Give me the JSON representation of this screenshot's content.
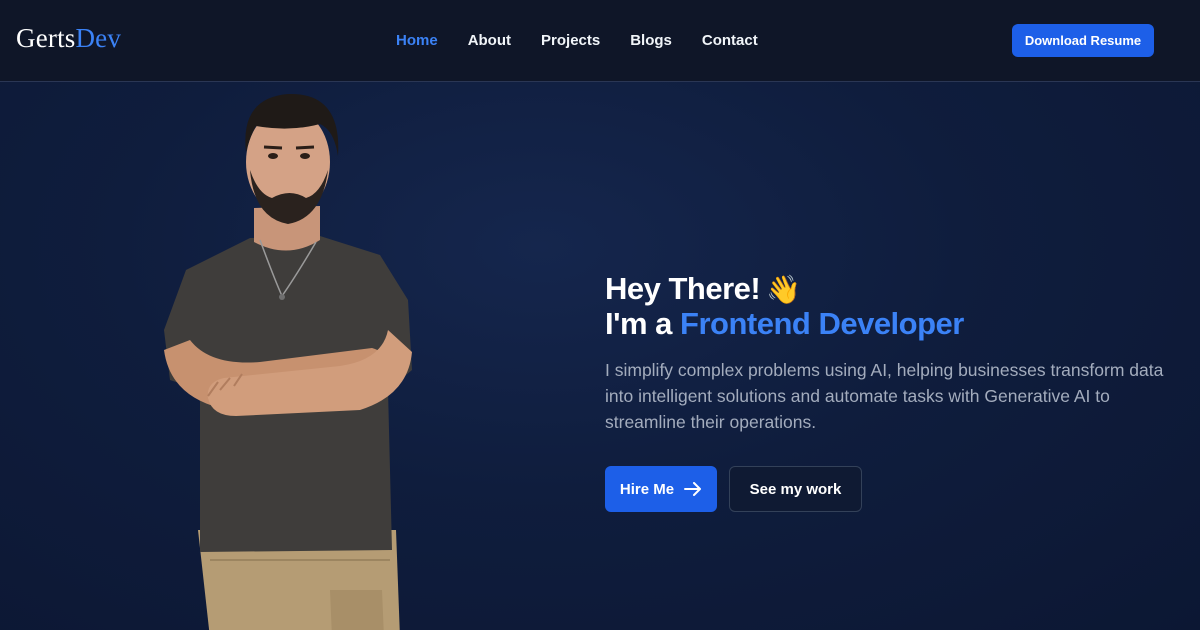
{
  "header": {
    "logo_primary": "Gerts",
    "logo_accent": "Dev",
    "nav": [
      {
        "label": "Home",
        "active": true
      },
      {
        "label": "About",
        "active": false
      },
      {
        "label": "Projects",
        "active": false
      },
      {
        "label": "Blogs",
        "active": false
      },
      {
        "label": "Contact",
        "active": false
      }
    ],
    "resume_label": "Download Resume"
  },
  "hero": {
    "greeting": "Hey There!",
    "greeting_emoji": "👋",
    "intro_prefix": "I'm a",
    "role": "Frontend Developer",
    "description": "I simplify complex problems using AI, helping businesses transform data into intelligent solutions and automate tasks with Generative AI to streamline their operations.",
    "primary_cta": "Hire Me",
    "secondary_cta": "See my work",
    "portrait_icon": "person-portrait"
  },
  "colors": {
    "accent": "#3b82f6",
    "button": "#1d5fe8",
    "background": "#0f1a36",
    "navbar": "#0f1628",
    "muted_text": "#a3acbd"
  }
}
